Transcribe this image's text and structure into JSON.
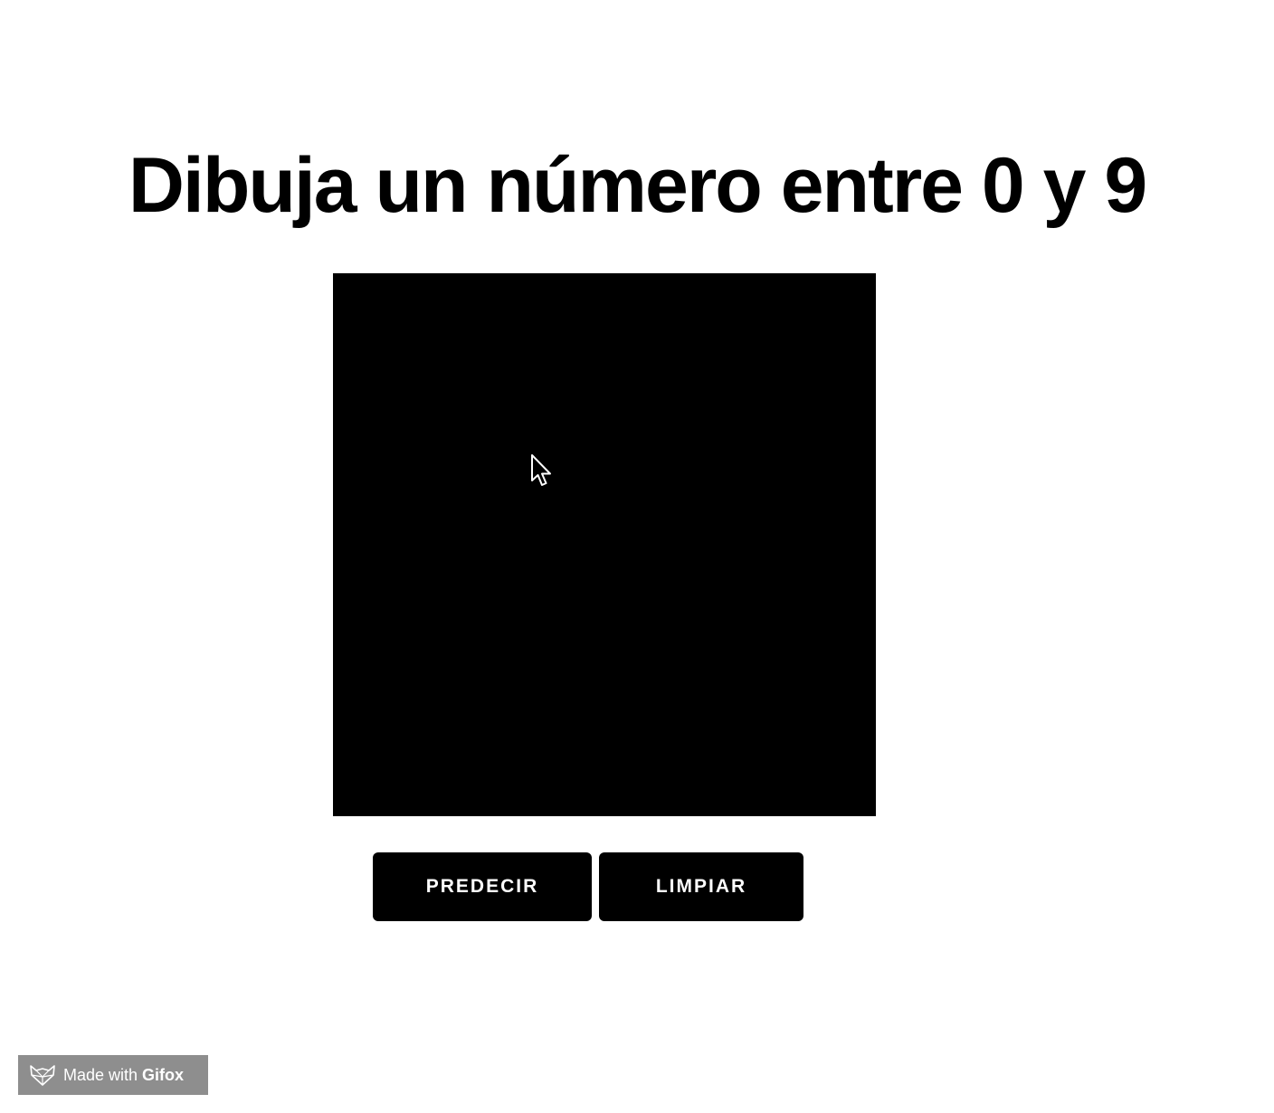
{
  "header": {
    "title": "Dibuja un número entre 0 y 9"
  },
  "canvas": {
    "background": "#000000",
    "cursor_icon": "arrow-pointer-icon"
  },
  "buttons": {
    "predict_label": "PREDECIR",
    "clear_label": "LIMPIAR"
  },
  "watermark": {
    "made_with": "Made with",
    "brand": "Gifox",
    "icon": "fox-icon"
  },
  "colors": {
    "page_background": "#ffffff",
    "button_background": "#000000",
    "button_text": "#ffffff",
    "watermark_background": "#8e8e8e"
  }
}
